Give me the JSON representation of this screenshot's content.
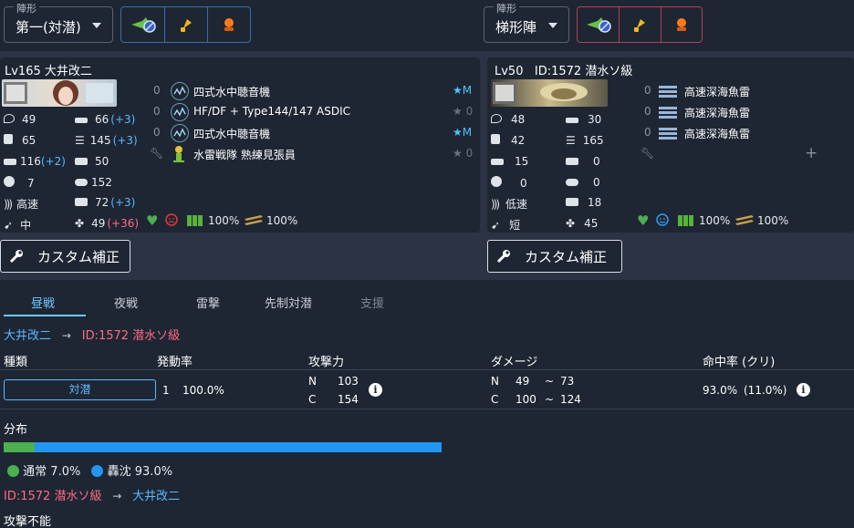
{
  "formation": {
    "left": {
      "legend": "陣形",
      "value": "第一(対潜)"
    },
    "right": {
      "legend": "陣形",
      "value": "梯形陣"
    }
  },
  "friendly": {
    "header": "Lv165  大井改二",
    "stats": {
      "hp": "49",
      "armor": "65",
      "evasion": "116",
      "evasion_bonus": "(+2)",
      "aircraft": "7",
      "speed": "高速",
      "range": "中",
      "firepower": "66",
      "firepower_bonus": "(+3)",
      "torpedo": "145",
      "torpedo_bonus": "(+3)",
      "aa": "50",
      "asw_plane": "152",
      "asw": "72",
      "asw_bonus": "(+3)",
      "luck": "49",
      "luck_bonus": "(+36)"
    },
    "equipment": [
      {
        "count": "0",
        "name": "四式水中聴音機",
        "rank": "★M"
      },
      {
        "count": "0",
        "name": "HF/DF + Type144/147 ASDIC",
        "rank": "★ 0"
      },
      {
        "count": "0",
        "name": "四式水中聴音機",
        "rank": "★M"
      },
      {
        "count": "",
        "name": "水雷戦隊 熟練見張員",
        "rank": "★ 0"
      }
    ],
    "status": {
      "fuel": "100%",
      "ammo": "100%"
    },
    "custom_label": "カスタム補正"
  },
  "enemy": {
    "header": "Lv50   ID:1572 潜水ソ級",
    "stats": {
      "hp": "48",
      "armor": "42",
      "evasion": "15",
      "aircraft": "0",
      "speed": "低速",
      "range": "短",
      "firepower": "30",
      "torpedo": "165",
      "aa": "0",
      "asw_plane": "0",
      "asw": "18",
      "luck": "45"
    },
    "equipment": [
      {
        "count": "0",
        "name": "高速深海魚雷"
      },
      {
        "count": "0",
        "name": "高速深海魚雷"
      },
      {
        "count": "0",
        "name": "高速深海魚雷"
      }
    ],
    "add_slot": "+",
    "status": {
      "fuel": "100%",
      "ammo": "100%"
    },
    "custom_label": "カスタム補正"
  },
  "tabs": [
    "昼戦",
    "夜戦",
    "雷撃",
    "先制対潜",
    "支援"
  ],
  "attack1": {
    "from": "大井改二",
    "arrow": "→",
    "to": "ID:1572 潜水ソ級"
  },
  "table": {
    "headers": {
      "type": "種類",
      "rate": "発動率",
      "power": "攻撃力",
      "damage": "ダメージ",
      "hit": "命中率 (クリ)"
    },
    "row": {
      "type": "対潜",
      "rate_n": "1",
      "rate": "100.0%",
      "power_n_label": "N",
      "power_n": "103",
      "power_c_label": "C",
      "power_c": "154",
      "dmg_n_label": "N",
      "dmg_n_min": "49",
      "dmg_n_sep": "~",
      "dmg_n_max": "73",
      "dmg_c_label": "C",
      "dmg_c_min": "100",
      "dmg_c_sep": "~",
      "dmg_c_max": "124",
      "hit": "93.0%",
      "crit": "(11.0%)"
    }
  },
  "distribution": {
    "title": "分布",
    "normal_label": "通常",
    "normal_pct": "7.0%",
    "normal_fraction": 0.07,
    "sunk_label": "轟沈",
    "sunk_pct": "93.0%",
    "sunk_fraction": 0.93,
    "colors": {
      "normal": "#4caf50",
      "sunk": "#2196f3"
    }
  },
  "attack2": {
    "from": "ID:1572 潜水ソ級",
    "arrow": "→",
    "to": "大井改二"
  },
  "no_attack": "攻撃不能"
}
